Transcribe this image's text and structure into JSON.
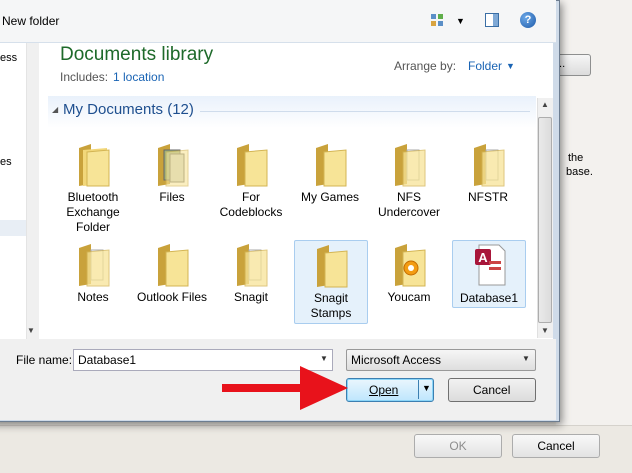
{
  "toolbar": {
    "new_folder": "New folder",
    "help": "?"
  },
  "library": {
    "title": "Documents library",
    "includes_label": "Includes:",
    "location_link": "1 location",
    "arrange_label": "Arrange by:",
    "arrange_value": "Folder"
  },
  "group": {
    "title": "My Documents (12)"
  },
  "items": [
    {
      "label": "Bluetooth Exchange Folder",
      "icon": "folder-icon"
    },
    {
      "label": "Files",
      "icon": "folder-images-icon"
    },
    {
      "label": "For Codeblocks",
      "icon": "folder-icon"
    },
    {
      "label": "My Games",
      "icon": "folder-icon"
    },
    {
      "label": "NFS Undercover",
      "icon": "folder-docs-icon"
    },
    {
      "label": "NFSTR",
      "icon": "folder-docs-icon"
    },
    {
      "label": "Notes",
      "icon": "folder-docs-icon"
    },
    {
      "label": "Outlook Files",
      "icon": "folder-icon"
    },
    {
      "label": "Snagit",
      "icon": "folder-docs-icon"
    },
    {
      "label": "Snagit Stamps",
      "icon": "folder-icon"
    },
    {
      "label": "Youcam",
      "icon": "folder-youcam-icon"
    },
    {
      "label": "Database1",
      "icon": "access-file-icon"
    }
  ],
  "file_name": {
    "label": "File name:",
    "value": "Database1"
  },
  "file_type": {
    "value": "Microsoft Access"
  },
  "buttons": {
    "open": "Open",
    "cancel": "Cancel"
  },
  "nav_fragments": {
    "text1": "ess",
    "text2": "es"
  },
  "background": {
    "btn_partial": "...",
    "text1": "the",
    "text2": "base.",
    "ok": "OK",
    "cancel": "Cancel"
  },
  "colors": {
    "library_title": "#1e6a2a",
    "link": "#1a64b4",
    "arrow": "#e8121b"
  }
}
